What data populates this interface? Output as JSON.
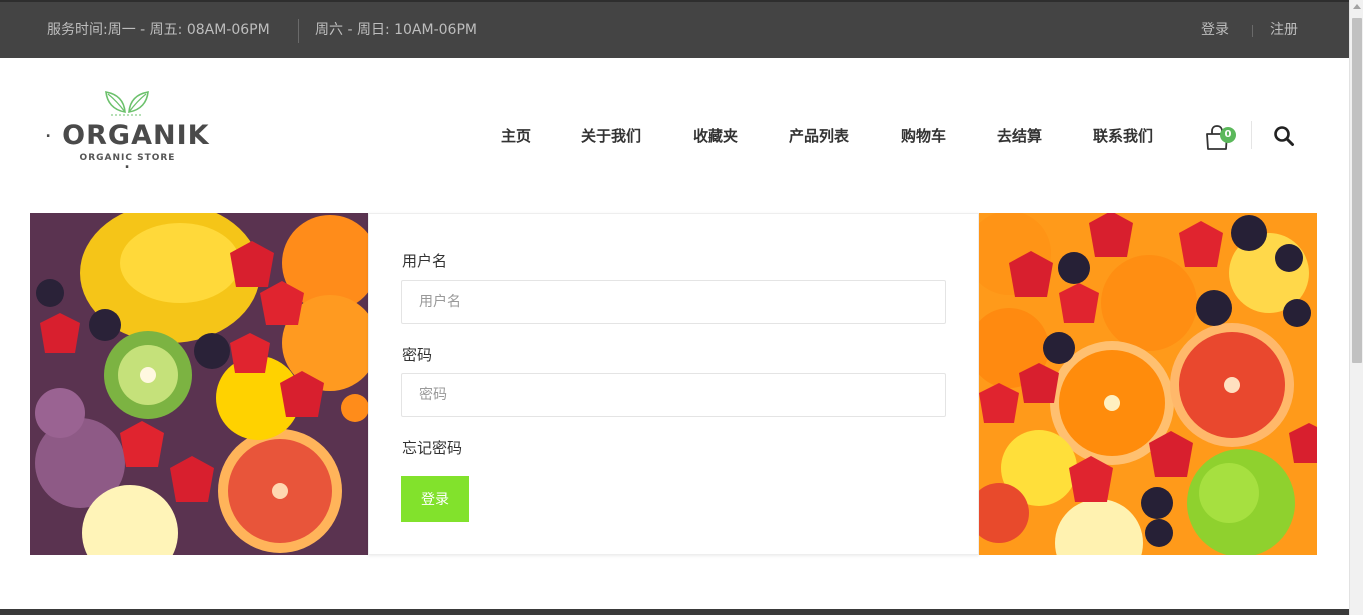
{
  "topbar": {
    "hours_weekday": "服务时间:周一 - 周五: 08AM-06PM",
    "hours_weekend": "周六 - 周日: 10AM-06PM",
    "login_label": "登录",
    "register_label": "注册"
  },
  "logo": {
    "brand": "ORGANIK",
    "tagline": "ORGANIC STORE"
  },
  "nav": {
    "items": [
      "主页",
      "关于我们",
      "收藏夹",
      "产品列表",
      "购物车",
      "去结算",
      "联系我们"
    ]
  },
  "cart": {
    "count": "0"
  },
  "login_form": {
    "username_label": "用户名",
    "username_placeholder": "用户名",
    "password_label": "密码",
    "password_placeholder": "密码",
    "forgot_label": "忘记密码",
    "submit_label": "登录"
  },
  "colors": {
    "topbar_bg": "#444444",
    "accent_green": "#82e22c",
    "badge_green": "#5bb85b"
  },
  "icons": [
    "leaf-logo-icon",
    "shopping-bag-icon",
    "search-icon"
  ]
}
